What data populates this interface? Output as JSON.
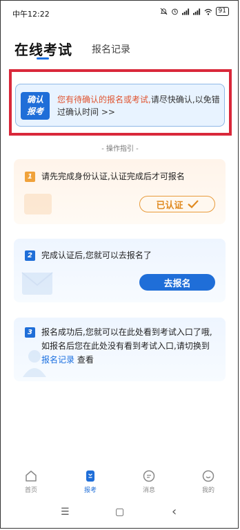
{
  "status_bar": {
    "time": "中午12:22",
    "battery": "91",
    "icons": [
      "mute-icon",
      "alarm-icon",
      "signal-icon",
      "signal-icon",
      "wifi-icon",
      "battery-icon"
    ]
  },
  "header": {
    "tabs": [
      {
        "label": "在线考试",
        "active": true
      },
      {
        "label": "报名记录",
        "active": false
      }
    ]
  },
  "notice": {
    "badge_line1": "确认",
    "badge_line2": "报考",
    "highlight": "您有待确认的报名或考试,",
    "rest": "请尽快确认,以免错过确认时间 >>"
  },
  "guide": {
    "title": "- 操作指引 -",
    "steps": [
      {
        "number": "1",
        "text": "请先完成身份认证,认证完成后才可报名",
        "button": "已认证"
      },
      {
        "number": "2",
        "text": "完成认证后,您就可以去报名了",
        "button": "去报名"
      },
      {
        "number": "3",
        "text_before": "报名成功后,您就可以在此处看到考试入口了哦,如报名后您在此处没有看到考试入口,请切换到",
        "link": "报名记录",
        "text_after": "查看"
      }
    ]
  },
  "bottom_nav": [
    {
      "label": "首页",
      "icon": "home-icon",
      "active": false
    },
    {
      "label": "报考",
      "icon": "exam-icon",
      "active": true
    },
    {
      "label": "消息",
      "icon": "message-icon",
      "active": false
    },
    {
      "label": "我的",
      "icon": "profile-icon",
      "active": false
    }
  ],
  "system_nav": {
    "menu": "☰",
    "home": "▢",
    "back": "‹"
  },
  "colors": {
    "accent": "#1f6ed8",
    "warning": "#e0532f",
    "highlight_frame": "#d9283a",
    "step1": "#f0a23b"
  }
}
